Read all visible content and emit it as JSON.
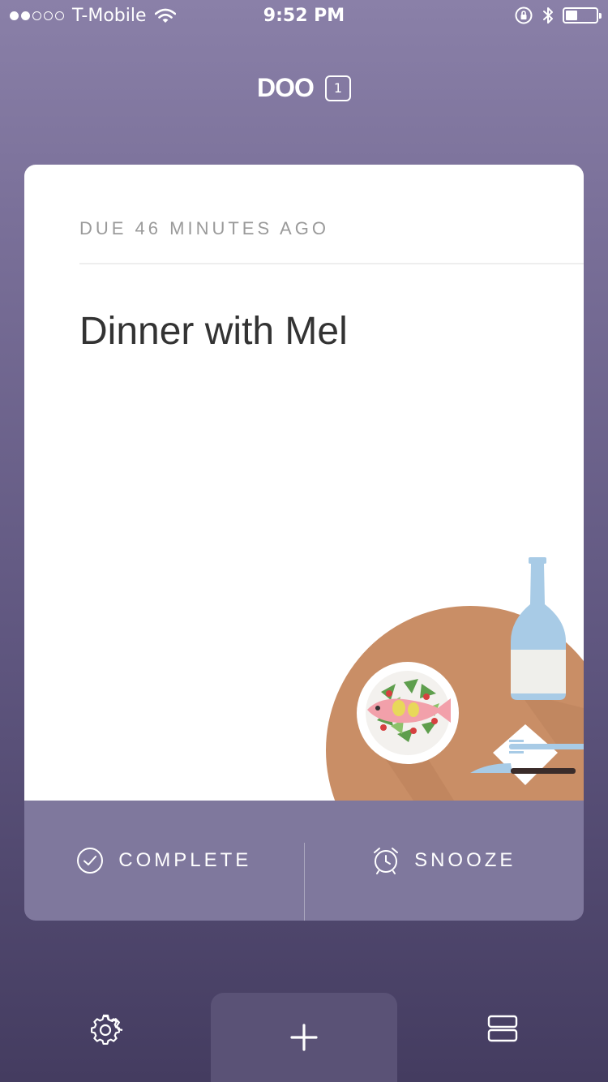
{
  "status_bar": {
    "carrier": "T-Mobile",
    "time": "9:52 PM",
    "signal_bars_filled": 2,
    "signal_bars_total": 5,
    "battery_level": 0.4
  },
  "header": {
    "app_name": "DOO",
    "task_count": "1"
  },
  "card": {
    "due_label": "DUE 46 MINUTES AGO",
    "title": "Dinner with Mel",
    "complete_label": "COMPLETE",
    "snooze_label": "SNOOZE"
  },
  "toolbar": {
    "settings_icon": "gear-icon",
    "add_icon": "plus-icon",
    "list_icon": "list-icon"
  },
  "colors": {
    "background_top": "#8a80a8",
    "background_bottom": "#443c60",
    "card_actions": "#7f789d",
    "add_button": "#5a5276",
    "table": "#c98e66"
  }
}
